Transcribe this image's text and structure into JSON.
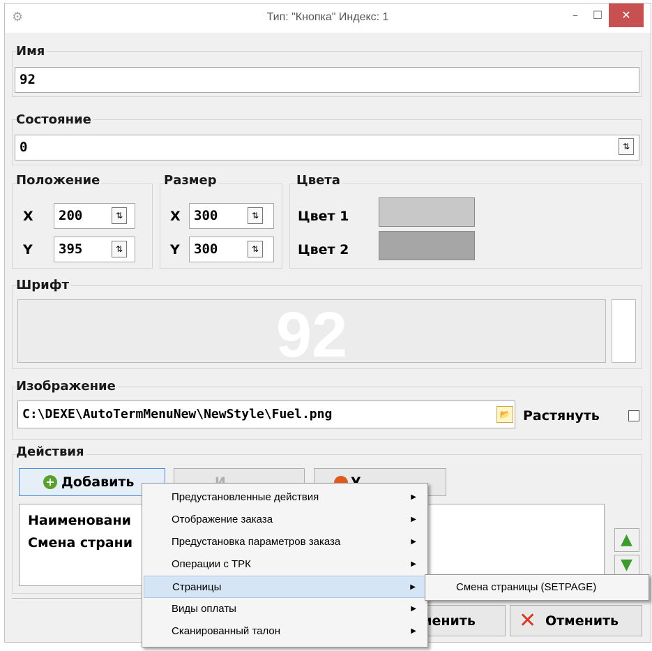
{
  "window": {
    "title": "Тип: \"Кнопка\" Индекс: 1",
    "minimize": "–",
    "maximize": "☐",
    "close": "✕"
  },
  "name_group": {
    "label": "Имя",
    "value": "92"
  },
  "state_group": {
    "label": "Состояние",
    "value": "0"
  },
  "position_group": {
    "label": "Положение",
    "x_label": "X",
    "x_value": "200",
    "y_label": "Y",
    "y_value": "395"
  },
  "size_group": {
    "label": "Размер",
    "x_label": "X",
    "x_value": "300",
    "y_label": "Y",
    "y_value": "300"
  },
  "colors_group": {
    "label": "Цвета",
    "color1_label": "Цвет 1",
    "color1": "#c8c8c8",
    "color2_label": "Цвет 2",
    "color2": "#a6a6a6"
  },
  "font_group": {
    "label": "Шрифт",
    "preview_text": "92"
  },
  "image_group": {
    "label": "Изображение",
    "path": "C:\\DEXE\\AutoTermMenuNew\\NewStyle\\Fuel.png",
    "stretch_label": "Растянуть",
    "stretch_checked": false
  },
  "actions_group": {
    "label": "Действия",
    "add_button": "Добавить",
    "edit_button": "И",
    "delete_button": "У",
    "list_items": [
      "Наименовани",
      "Смена страни"
    ]
  },
  "footer": {
    "apply_button": "менить",
    "cancel_button": "Отменить"
  },
  "context_menu": {
    "items": [
      {
        "label": "Предустановленные действия"
      },
      {
        "label": "Отображение заказа"
      },
      {
        "label": "Предустановка параметров заказа"
      },
      {
        "label": "Операции с ТРК"
      },
      {
        "label": "Страницы"
      },
      {
        "label": "Виды оплаты"
      },
      {
        "label": "Сканированный талон"
      }
    ],
    "submenu_item": "Смена страницы (SETPAGE)"
  }
}
